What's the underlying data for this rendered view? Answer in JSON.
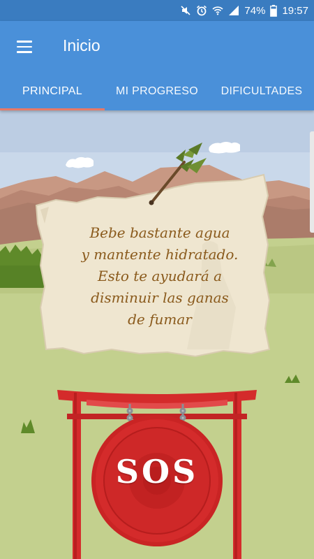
{
  "status_bar": {
    "battery": "74%",
    "time": "19:57",
    "icons": [
      "mute-icon",
      "alarm-icon",
      "wifi-icon",
      "signal-icon",
      "battery-icon"
    ]
  },
  "app_bar": {
    "title": "Inicio",
    "menu_icon": "hamburger-menu-icon"
  },
  "tabs": [
    {
      "label": "PRINCIPAL",
      "active": true
    },
    {
      "label": "MI PROGRESO",
      "active": false
    },
    {
      "label": "DIFICULTADES",
      "active": false
    }
  ],
  "tip": {
    "lines": [
      "Bebe bastante agua",
      "y mantente hidratado.",
      "Esto te ayudará a",
      "disminuir las ganas",
      "de fumar"
    ]
  },
  "sos_button": {
    "label": "SOS"
  },
  "colors": {
    "app_bar": "#4a90d9",
    "status_bar": "#3a7cc0",
    "tab_indicator": "#e87966",
    "sky": "#c7d6e8",
    "grass": "#c3d08e",
    "parchment": "#efe6d0",
    "tip_text": "#8a5a1c",
    "gong_red": "#d42b2b"
  }
}
